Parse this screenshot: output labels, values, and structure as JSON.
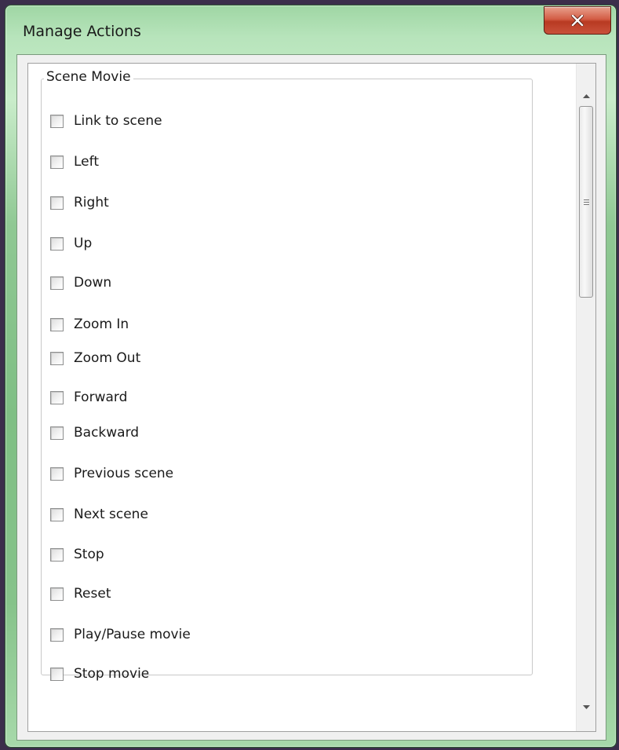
{
  "window": {
    "title": "Manage Actions",
    "close_label": "×"
  },
  "group": {
    "label": "Scene  Movie"
  },
  "actions": [
    {
      "label": "Link to scene",
      "checked": false
    },
    {
      "label": "Left",
      "checked": false
    },
    {
      "label": "Right",
      "checked": false
    },
    {
      "label": "Up",
      "checked": false
    },
    {
      "label": "Down",
      "checked": false
    },
    {
      "label": "Zoom In",
      "checked": false
    },
    {
      "label": "Zoom Out",
      "checked": false
    },
    {
      "label": "Forward",
      "checked": false
    },
    {
      "label": "Backward",
      "checked": false
    },
    {
      "label": "Previous scene",
      "checked": false
    },
    {
      "label": "Next scene",
      "checked": false
    },
    {
      "label": "Stop",
      "checked": false
    },
    {
      "label": "Reset",
      "checked": false
    },
    {
      "label": "Play/Pause movie",
      "checked": false
    },
    {
      "label": "Stop movie",
      "checked": false
    }
  ],
  "colors": {
    "title_bar_accent": "#9fd6a4",
    "close_button": "#c9513a",
    "client_background": "#f0f0f0",
    "list_background": "#ffffff"
  },
  "icons": {
    "close": "close-icon",
    "scroll_up": "arrow-up-icon",
    "scroll_down": "arrow-down-icon",
    "thumb_grip": "grip-icon"
  }
}
